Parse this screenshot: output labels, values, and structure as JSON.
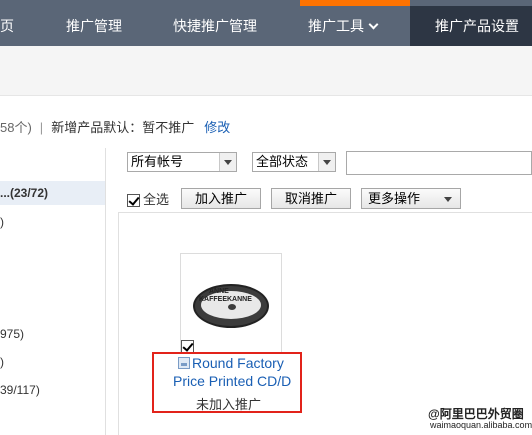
{
  "nav": {
    "items": [
      {
        "label": "页"
      },
      {
        "label": "推广管理"
      },
      {
        "label": "快捷推广管理"
      },
      {
        "label": "推广工具"
      },
      {
        "label": "推广产品设置"
      }
    ]
  },
  "info": {
    "count": "58个)",
    "separator": "|",
    "default_label": "新增产品默认：",
    "default_value": "暂不推广",
    "edit_link": "修改"
  },
  "sidebar": {
    "rows": [
      {
        "label": "...(23/72)"
      },
      {
        "label": ")"
      },
      {
        "label": "975)"
      },
      {
        "label": ")"
      },
      {
        "label": "39/117)"
      }
    ]
  },
  "filters": {
    "account": "所有帐号",
    "status": "全部状态"
  },
  "actions": {
    "select_all": "全选",
    "add": "加入推广",
    "cancel": "取消推广",
    "more": "更多操作"
  },
  "product": {
    "image_text_line1": "ANNE",
    "image_text_line2": "KAFFEEKANNE",
    "title_line1": "Round Factory",
    "title_line2": "Price Printed CD/D",
    "status": "未加入推广"
  },
  "watermark": {
    "line1": "@阿里巴巴外贸圈",
    "line2": "waimaoquan.alibaba.com"
  },
  "colors": {
    "nav_bg": "#5a6677",
    "nav_active": "#2d3644",
    "accent": "#ff7300",
    "link": "#1a5fb4",
    "highlight_box": "#e2231a"
  }
}
